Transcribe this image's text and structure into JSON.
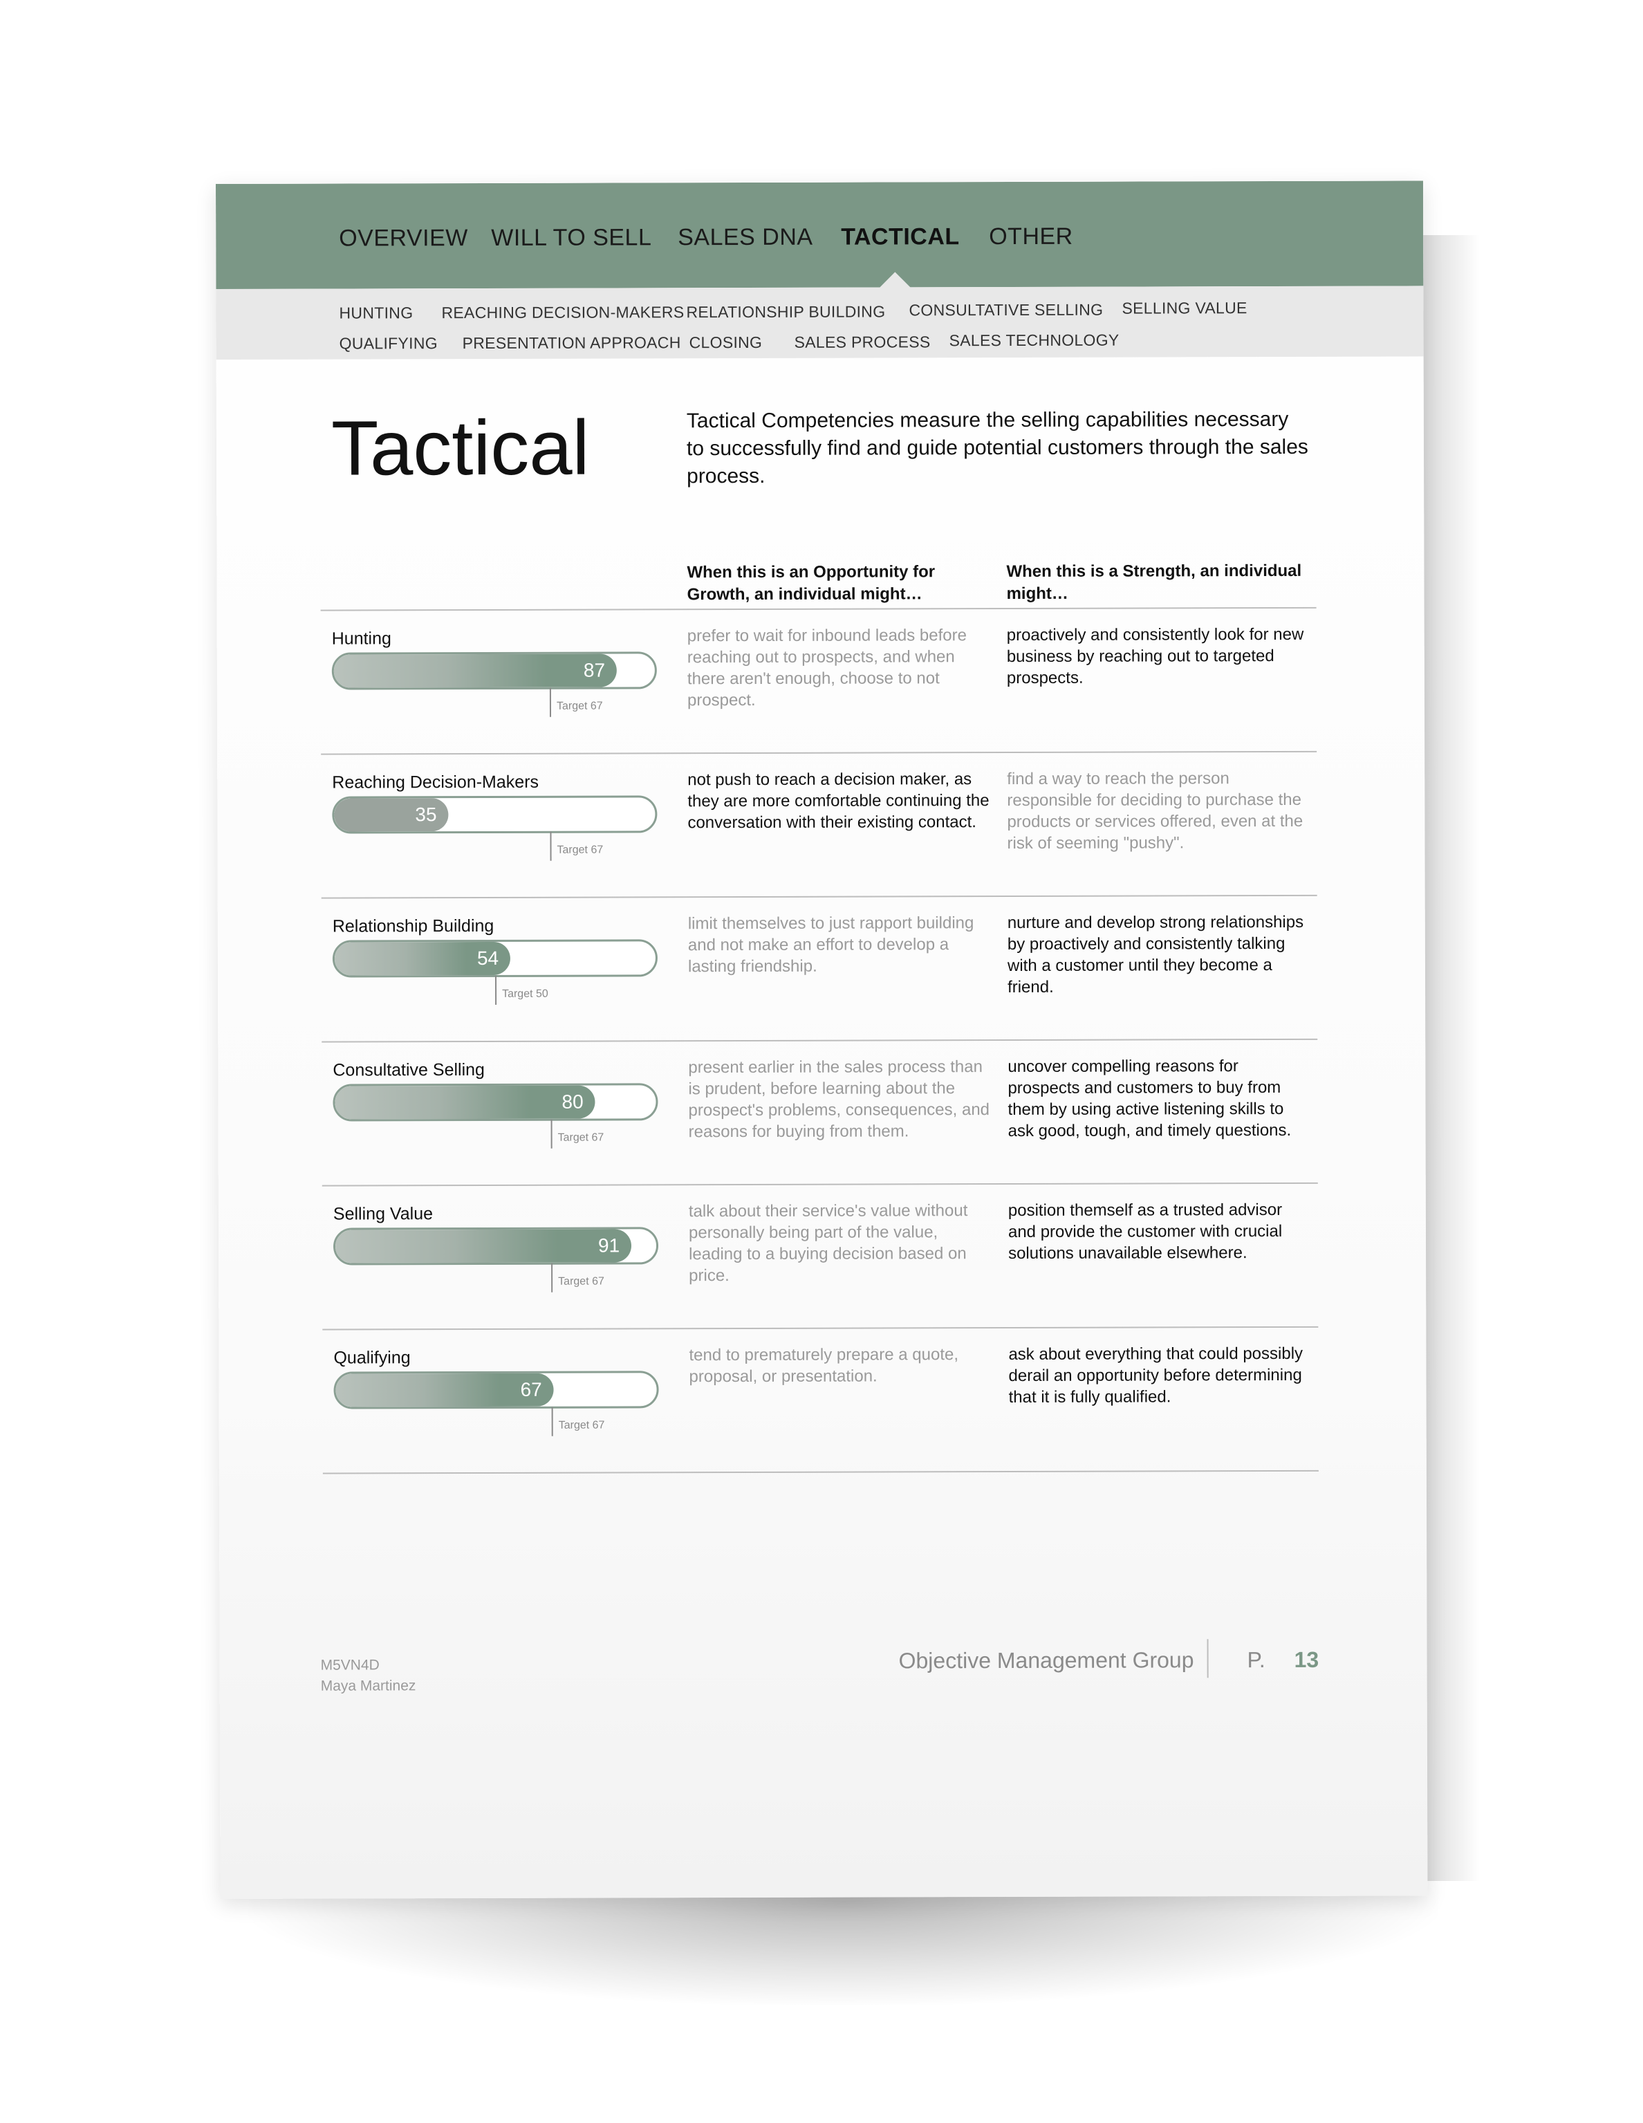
{
  "nav": {
    "tabs": [
      "OVERVIEW",
      "WILL TO SELL",
      "SALES DNA",
      "TACTICAL",
      "OTHER"
    ],
    "active": "TACTICAL",
    "sub_row1": [
      "HUNTING",
      "REACHING DECISION-MAKERS",
      "RELATIONSHIP BUILDING",
      "CONSULTATIVE SELLING",
      "SELLING VALUE"
    ],
    "sub_row2": [
      "QUALIFYING",
      "PRESENTATION APPROACH",
      "CLOSING",
      "SALES PROCESS",
      "SALES TECHNOLOGY"
    ]
  },
  "title": "Tactical",
  "intro": "Tactical Competencies measure the selling capabilities necessary to successfully find and guide potential customers through the sales process.",
  "col_opportunity": "When this is an Opportunity for Growth, an individual might…",
  "col_strength": "When this is a Strength, an individual might…",
  "rows": [
    {
      "label": "Hunting",
      "score": 87,
      "score_text": "87",
      "target": 67,
      "target_text": "Target 67",
      "opportunity": "prefer to wait for inbound leads before reaching out to prospects, and when there aren't enough, choose to not prospect.",
      "strength": "proactively and consistently look for new business by reaching out to targeted prospects.",
      "is_strength": true
    },
    {
      "label": "Reaching Decision-Makers",
      "score": 35,
      "score_text": "35",
      "target": 67,
      "target_text": "Target 67",
      "opportunity": "not push to reach a decision maker, as they are more comfortable continuing the conversation with their existing contact.",
      "strength": "find a way to reach the person responsible for deciding to purchase the products or services offered, even at the risk of seeming \"pushy\".",
      "is_strength": false
    },
    {
      "label": "Relationship Building",
      "score": 54,
      "score_text": "54",
      "target": 50,
      "target_text": "Target 50",
      "opportunity": "limit themselves to just rapport building and not make an effort to develop a lasting friendship.",
      "strength": "nurture and develop strong relationships by proactively and consistently talking with a customer until they become a friend.",
      "is_strength": true
    },
    {
      "label": "Consultative Selling",
      "score": 80,
      "score_text": "80",
      "target": 67,
      "target_text": "Target 67",
      "opportunity": "present earlier in the sales process than is prudent, before learning about the prospect's problems, consequences, and reasons for buying from them.",
      "strength": "uncover compelling reasons for prospects and customers to buy from them by using active listening skills to ask good, tough, and timely questions.",
      "is_strength": true
    },
    {
      "label": "Selling Value",
      "score": 91,
      "score_text": "91",
      "target": 67,
      "target_text": "Target 67",
      "opportunity": "talk about their service's value without personally being part of the value, leading to a buying decision based on price.",
      "strength": "position themself as a trusted advisor and provide the customer with crucial solutions unavailable elsewhere.",
      "is_strength": true
    },
    {
      "label": "Qualifying",
      "score": 67,
      "score_text": "67",
      "target": 67,
      "target_text": "Target 67",
      "opportunity": "tend to prematurely prepare a quote, proposal, or presentation.",
      "strength": "ask about everything that could possibly derail an opportunity before determining that it is fully qualified.",
      "is_strength": true
    }
  ],
  "footer": {
    "code": "M5VN4D",
    "name": "Maya Martinez",
    "org": "Objective Management Group",
    "page_prefix": "P.",
    "page_number": "13"
  },
  "colors": {
    "accent": "#7b9786",
    "muted_text": "#9a9a9a",
    "subnav_bg": "#e8e8e8"
  }
}
